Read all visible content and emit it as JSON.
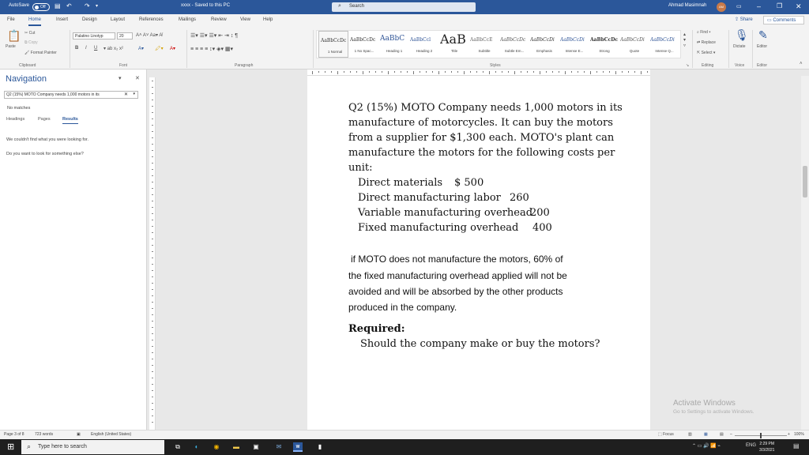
{
  "titlebar": {
    "autosave_label": "AutoSave",
    "autosave_state": "Off",
    "doc_title": "xxxx - Saved to this PC",
    "search_placeholder": "Search",
    "user_name": "Ahmad Masimnah",
    "user_initials": "AM"
  },
  "menu": {
    "tabs": [
      "File",
      "Home",
      "Insert",
      "Design",
      "Layout",
      "References",
      "Mailings",
      "Review",
      "View",
      "Help"
    ],
    "share": "Share",
    "comments": "Comments"
  },
  "ribbon": {
    "clipboard": {
      "paste": "Paste",
      "cut": "Cut",
      "copy": "Copy",
      "format_painter": "Format Painter",
      "group": "Clipboard"
    },
    "font": {
      "family": "Palatino Linotyp",
      "size": "20",
      "group": "Font"
    },
    "paragraph": {
      "group": "Paragraph"
    },
    "styles": {
      "group": "Styles",
      "items": [
        {
          "preview": "AaBbCcDc",
          "name": "1 Normal"
        },
        {
          "preview": "AaBbCcDc",
          "name": "1 No Spac..."
        },
        {
          "preview": "AaBbC",
          "name": "Heading 1"
        },
        {
          "preview": "AaBbCcl",
          "name": "Heading 2"
        },
        {
          "preview": "AaB",
          "name": "Title"
        },
        {
          "preview": "AaBbCcE",
          "name": "Subtitle"
        },
        {
          "preview": "AaBbCcDc",
          "name": "Subtle Em..."
        },
        {
          "preview": "AaBbCcDi",
          "name": "Emphasis"
        },
        {
          "preview": "AaBbCcDi",
          "name": "Intense E..."
        },
        {
          "preview": "AaBbCcDc",
          "name": "Strong"
        },
        {
          "preview": "AaBbCcDi",
          "name": "Quote"
        },
        {
          "preview": "AaBbCcDi",
          "name": "Intense Q..."
        }
      ]
    },
    "editing": {
      "find": "Find",
      "replace": "Replace",
      "select": "Select",
      "group": "Editing"
    },
    "voice": {
      "dictate": "Dictate",
      "group": "Voice"
    },
    "editor": {
      "label": "Editor",
      "group": "Editor"
    }
  },
  "navigation": {
    "title": "Navigation",
    "search_value": "Q2 (15%) MOTO Company needs 1,000 motors in its",
    "no_matches": "No matches",
    "tabs": [
      "Headings",
      "Pages",
      "Results"
    ],
    "msg1": "We couldn't find what you were looking for.",
    "msg2": "Do you want to look for something else?"
  },
  "document": {
    "q_lines": [
      "Q2 (15%) MOTO Company needs 1,000 motors in its",
      "manufacture of motorcycles. It can buy the motors",
      "from a supplier for $1,300 each. MOTO's plant can",
      "manufacture the motors for the following costs per",
      "unit:"
    ],
    "costs": [
      {
        "label": "Direct materials",
        "value": "$ 500"
      },
      {
        "label": "Direct manufacturing labor",
        "value": "260"
      },
      {
        "label": "Variable manufacturing overhead",
        "value": "200"
      },
      {
        "label": "Fixed manufacturing overhead",
        "value": "400"
      }
    ],
    "note_lines": [
      "if MOTO does not manufacture the motors, 60% of",
      "the fixed manufacturing overhead applied will not be",
      "avoided and will be absorbed by the other products",
      "produced in the company."
    ],
    "required_label": "Required:",
    "required_text": "Should the company make or buy the motors?"
  },
  "watermark": {
    "line1": "Activate Windows",
    "line2": "Go to Settings to activate Windows."
  },
  "statusbar": {
    "page": "Page 3 of 8",
    "words": "723 words",
    "language": "English (United States)",
    "focus": "Focus",
    "zoom": "100%"
  },
  "taskbar": {
    "search_placeholder": "Type here to search",
    "lang": "ENG",
    "time": "2:29 PM",
    "date": "3/3/2021"
  }
}
